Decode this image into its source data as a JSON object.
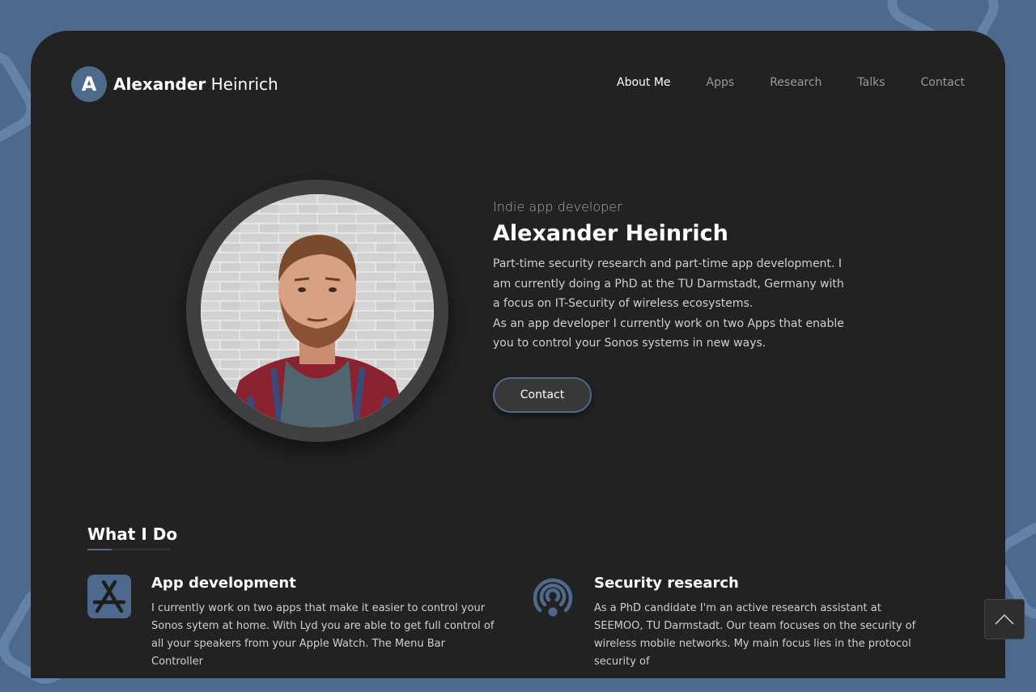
{
  "header": {
    "logo_letter": "A",
    "name_first": "Alexander",
    "name_last": "Heinrich",
    "nav": [
      {
        "label": "About Me",
        "active": true
      },
      {
        "label": "Apps"
      },
      {
        "label": "Research"
      },
      {
        "label": "Talks"
      },
      {
        "label": "Contact"
      }
    ]
  },
  "hero": {
    "kicker": "Indie app developer",
    "title": "Alexander Heinrich",
    "description_1": "Part-time security research and part-time app development. I am currently doing a PhD at the TU Darmstadt, Germany with a focus on IT-Security of wireless ecosystems.",
    "description_2": "As an app developer I currently work on two Apps that enable you to control your Sonos systems in new ways.",
    "contact_label": "Contact"
  },
  "what_i_do": {
    "title": "What I Do",
    "services": [
      {
        "icon": "app-store-icon",
        "title": "App development",
        "description": "I currently work on two apps that make it easier to control your Sonos sytem at home. With Lyd you are able to get full control of all your speakers from your Apple Watch. The Menu Bar Controller"
      },
      {
        "icon": "wireless-broadcast-icon",
        "title": "Security research",
        "description": "As a PhD candidate I'm an active research assistant at SEEMOO, TU Darmstadt. Our team focuses on the security of wireless mobile networks. My main focus lies in the protocol security of"
      }
    ]
  },
  "colors": {
    "accent": "#4d6a8c",
    "card": "#222222",
    "page_bg": "#4d6a8c"
  }
}
